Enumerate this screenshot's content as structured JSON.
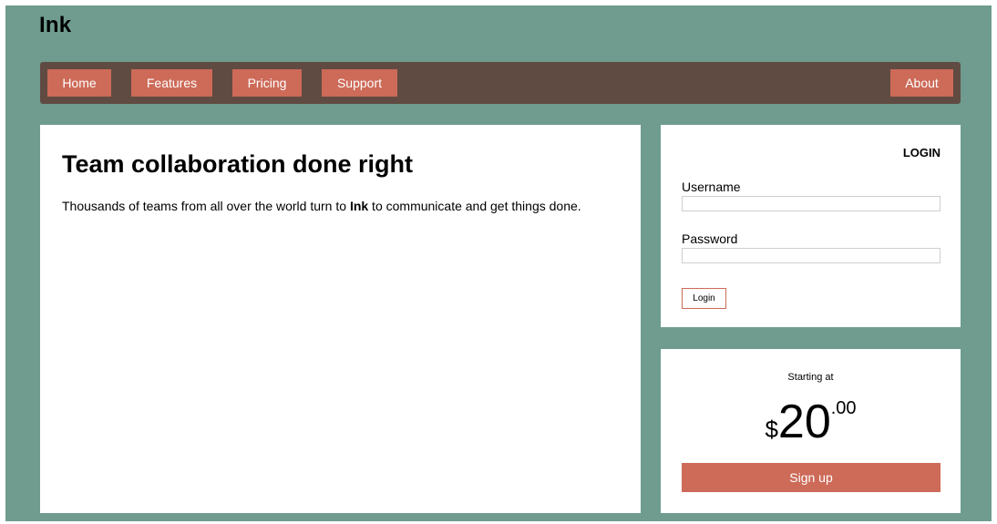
{
  "site": {
    "brand": "Ink"
  },
  "nav": {
    "home": "Home",
    "features": "Features",
    "pricing": "Pricing",
    "support": "Support",
    "about": "About"
  },
  "hero": {
    "heading": "Team collaboration done right",
    "text_before": "Thousands of teams from all over the world turn to ",
    "text_brand": "Ink",
    "text_after": " to communicate and get things done."
  },
  "login": {
    "title": "LOGIN",
    "username_label": "Username",
    "username_value": "",
    "password_label": "Password",
    "password_value": "",
    "button": "Login"
  },
  "pricing_box": {
    "starting_label": "Starting at",
    "currency": "$",
    "dollars": "20",
    "cents": ".00",
    "signup_button": "Sign up"
  },
  "colors": {
    "background": "#6f9c8f",
    "navbar": "#604b42",
    "accent": "#cd6a58",
    "card": "#ffffff"
  }
}
